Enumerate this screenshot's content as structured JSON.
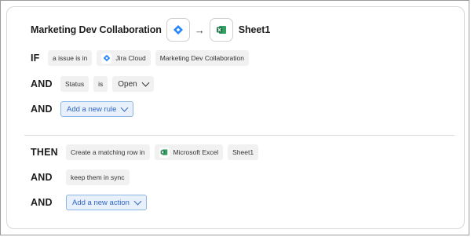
{
  "header": {
    "title": "Marketing Dev Collaboration",
    "arrow": "→",
    "target": "Sheet1",
    "source_icon": "jira-diamond-icon",
    "target_icon": "excel-icon"
  },
  "trigger": {
    "if_label": "IF",
    "and_label": "AND",
    "issue_prefix": "a issue is in",
    "app": "Jira Cloud",
    "project": "Marketing Dev Collaboration",
    "status_field": "Status",
    "operator": "is",
    "status_value": "Open",
    "add_rule_label": "Add a new rule"
  },
  "action": {
    "then_label": "THEN",
    "and_label": "AND",
    "create_text": "Create a matching row in",
    "app": "Microsoft Excel",
    "sheet": "Sheet1",
    "sync_text": "keep them in sync",
    "add_action_label": "Add a new action"
  },
  "colors": {
    "jira_blue": "#2684ff",
    "excel_green": "#1e7145",
    "accent_blue": "#2e66c4"
  }
}
